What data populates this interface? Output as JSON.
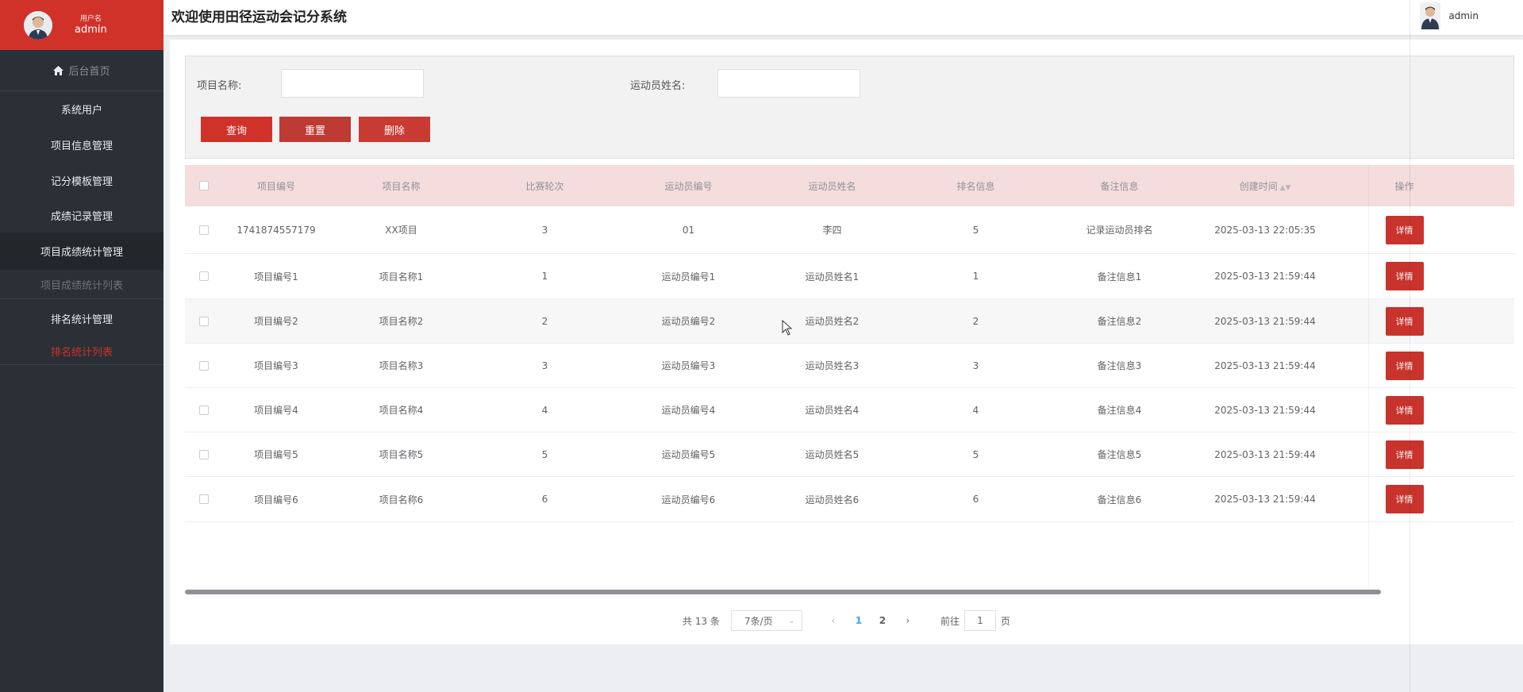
{
  "sidebar": {
    "user_label": "用户名",
    "user_name": "admin",
    "home": "后台首页",
    "items": [
      {
        "label": "系统用户"
      },
      {
        "label": "项目信息管理"
      },
      {
        "label": "记分模板管理"
      },
      {
        "label": "成绩记录管理"
      },
      {
        "label": "项目成绩统计管理"
      },
      {
        "label": "项目成绩统计列表"
      },
      {
        "label": "排名统计管理"
      },
      {
        "label": "排名统计列表"
      }
    ]
  },
  "header": {
    "title": "欢迎使用田径运动会记分系统",
    "user": "admin"
  },
  "search": {
    "project_name_label": "项目名称:",
    "athlete_name_label": "运动员姓名:",
    "project_name_value": "",
    "athlete_name_value": "",
    "query": "查询",
    "reset": "重置",
    "delete": "删除"
  },
  "table": {
    "headers": [
      "项目编号",
      "项目名称",
      "比赛轮次",
      "运动员编号",
      "运动员姓名",
      "排名信息",
      "备注信息",
      "创建时间",
      "操作"
    ],
    "rows": [
      [
        "1741874557179",
        "XX项目",
        "3",
        "01",
        "李四",
        "5",
        "记录运动员排名",
        "2025-03-13 22:05:35"
      ],
      [
        "项目编号1",
        "项目名称1",
        "1",
        "运动员编号1",
        "运动员姓名1",
        "1",
        "备注信息1",
        "2025-03-13 21:59:44"
      ],
      [
        "项目编号2",
        "项目名称2",
        "2",
        "运动员编号2",
        "运动员姓名2",
        "2",
        "备注信息2",
        "2025-03-13 21:59:44"
      ],
      [
        "项目编号3",
        "项目名称3",
        "3",
        "运动员编号3",
        "运动员姓名3",
        "3",
        "备注信息3",
        "2025-03-13 21:59:44"
      ],
      [
        "项目编号4",
        "项目名称4",
        "4",
        "运动员编号4",
        "运动员姓名4",
        "4",
        "备注信息4",
        "2025-03-13 21:59:44"
      ],
      [
        "项目编号5",
        "项目名称5",
        "5",
        "运动员编号5",
        "运动员姓名5",
        "5",
        "备注信息5",
        "2025-03-13 21:59:44"
      ],
      [
        "项目编号6",
        "项目名称6",
        "6",
        "运动员编号6",
        "运动员姓名6",
        "6",
        "备注信息6",
        "2025-03-13 21:59:44"
      ]
    ],
    "detail": "详情"
  },
  "pager": {
    "total": "共 13 条",
    "page_size": "7条/页",
    "pages": [
      "1",
      "2"
    ],
    "current": "1",
    "goto_label": "前往",
    "goto_value": "1",
    "goto_suffix": "页"
  },
  "colors": {
    "brand": "#d0322a",
    "sidebar": "#2b2f36",
    "table_header": "#f5dcdd",
    "pager_active": "#409eff"
  }
}
